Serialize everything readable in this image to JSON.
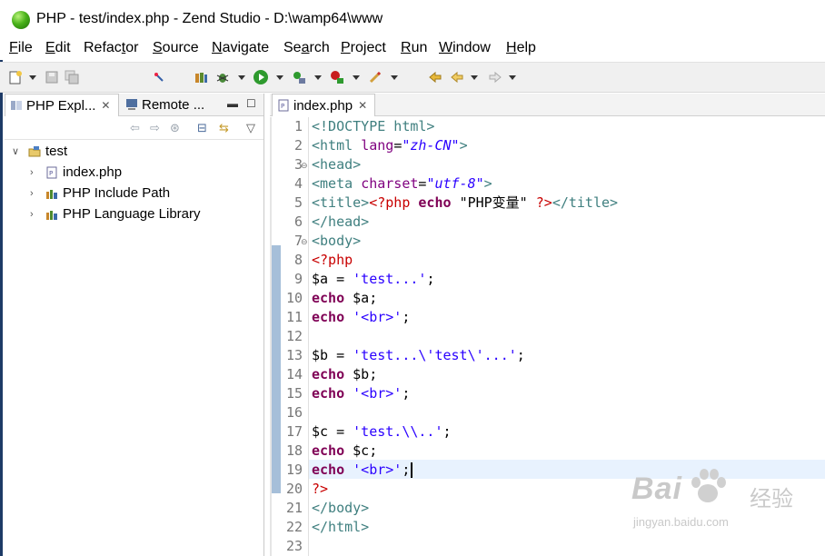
{
  "window": {
    "title": "PHP - test/index.php - Zend Studio - D:\\wamp64\\www"
  },
  "menu": [
    {
      "pre": "",
      "ul": "F",
      "post": "ile"
    },
    {
      "pre": "",
      "ul": "E",
      "post": "dit"
    },
    {
      "pre": "Refac",
      "ul": "t",
      "post": "or"
    },
    {
      "pre": "",
      "ul": "S",
      "post": "ource"
    },
    {
      "pre": "",
      "ul": "N",
      "post": "avigate"
    },
    {
      "pre": "Se",
      "ul": "a",
      "post": "rch"
    },
    {
      "pre": "",
      "ul": "P",
      "post": "roject"
    },
    {
      "pre": "",
      "ul": "R",
      "post": "un"
    },
    {
      "pre": "",
      "ul": "W",
      "post": "indow"
    },
    {
      "pre": "",
      "ul": "H",
      "post": "elp"
    }
  ],
  "left_view": {
    "tab1": "PHP Expl...",
    "tab2": "Remote ...",
    "tree": {
      "project": "test",
      "items": [
        "index.php",
        "PHP Include Path",
        "PHP Language Library"
      ]
    }
  },
  "editor": {
    "tab": "index.php",
    "line_numbers": [
      "1",
      "2",
      "3",
      "4",
      "5",
      "6",
      "7",
      "8",
      "9",
      "10",
      "11",
      "12",
      "13",
      "14",
      "15",
      "16",
      "17",
      "18",
      "19",
      "20",
      "21",
      "22",
      "23"
    ]
  },
  "code": {
    "l1_tag": "<!DOCTYPE html>",
    "l2_tag": "<html",
    "l2_attr": "lang",
    "l2_eq": "=",
    "l2_val": "\"zh-CN\"",
    "l2_end": ">",
    "l3": "<head>",
    "l4_tag": "<meta",
    "l4_attr": "charset",
    "l4_eq": "=",
    "l4_val": "\"utf-8\"",
    "l4_end": ">",
    "l5_tag": "<title>",
    "l5_php": "<?php",
    "l5_kw": "echo",
    "l5_str": "\"PHP变量\"",
    "l5_close": "?>",
    "l5_end": "</title>",
    "l6": "</head>",
    "l7": "<body>",
    "l8": "<?php",
    "l9_var": "$a = ",
    "l9_str": "'test...'",
    "l9_end": ";",
    "l10_kw": "echo",
    "l10_rest": " $a;",
    "l11_kw": "echo",
    "l11_str": " '<br>'",
    "l11_end": ";",
    "l13_var": "$b = ",
    "l13_str": "'test...\\'test\\'...'",
    "l13_end": ";",
    "l14_kw": "echo",
    "l14_rest": " $b;",
    "l15_kw": "echo",
    "l15_str": " '<br>'",
    "l15_end": ";",
    "l17_var": "$c = ",
    "l17_str": "'test.\\\\..'",
    "l17_end": ";",
    "l18_kw": "echo",
    "l18_rest": " $c;",
    "l19_kw": "echo",
    "l19_str": " '<br>'",
    "l19_end": ";",
    "l20": "?>",
    "l21": "</body>",
    "l22": "</html>"
  },
  "watermark": {
    "brand": "Bai",
    "brand2": "经验",
    "url": "jingyan.baidu.com"
  },
  "colors": {
    "tag": "#3f7f7f",
    "attr": "#7f007f",
    "string": "#2a00ff",
    "php_delim": "#c80000",
    "keyword": "#7f0055",
    "current_line": "#e8f2fe"
  }
}
